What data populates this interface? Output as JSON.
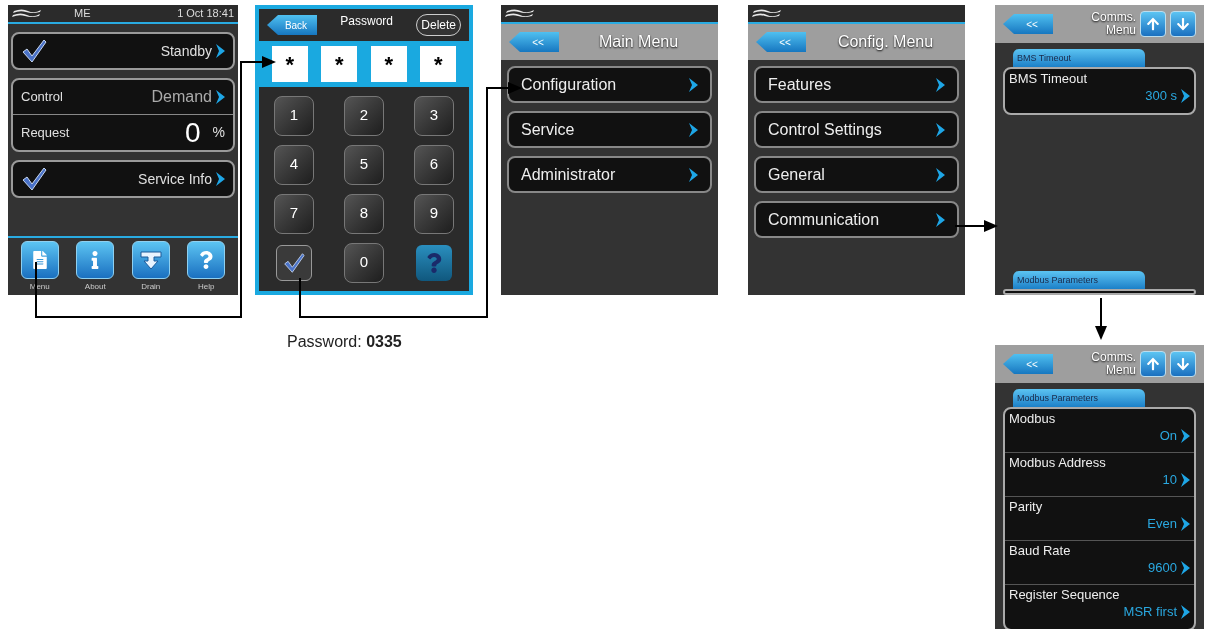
{
  "home_screen": {
    "status_bar": {
      "label": "ME",
      "datetime": "1 Oct 18:41"
    },
    "status_button": {
      "checked": true,
      "label": "Standby"
    },
    "control": {
      "label": "Control",
      "value": "Demand"
    },
    "request": {
      "label": "Request",
      "value": "0",
      "unit": "%"
    },
    "service_button": {
      "checked": true,
      "label": "Service Info"
    },
    "toolbar": [
      {
        "kind": "menu",
        "label": "Menu"
      },
      {
        "kind": "info",
        "label": "About"
      },
      {
        "kind": "drain",
        "label": "Drain"
      },
      {
        "kind": "help",
        "label": "Help"
      }
    ]
  },
  "password_screen": {
    "back": "Back",
    "title": "Password",
    "delete": "Delete",
    "digits": [
      "*",
      "*",
      "*",
      "*"
    ],
    "keys": [
      {
        "kind": "digit",
        "label": "1"
      },
      {
        "kind": "digit",
        "label": "2"
      },
      {
        "kind": "digit",
        "label": "3"
      },
      {
        "kind": "digit",
        "label": "4"
      },
      {
        "kind": "digit",
        "label": "5"
      },
      {
        "kind": "digit",
        "label": "6"
      },
      {
        "kind": "digit",
        "label": "7"
      },
      {
        "kind": "digit",
        "label": "8"
      },
      {
        "kind": "digit",
        "label": "9"
      },
      {
        "kind": "confirm"
      },
      {
        "kind": "digit",
        "label": "0"
      },
      {
        "kind": "help"
      }
    ]
  },
  "caption": "Password: **0335**",
  "main_menu": {
    "back": "<<",
    "title": "Main Menu",
    "items": [
      "Configuration",
      "Service",
      "Administrator"
    ]
  },
  "config_menu": {
    "back": "<<",
    "title": "Config. Menu",
    "items": [
      "Features",
      "Control Settings",
      "General",
      "Communication"
    ]
  },
  "comms_menu_views": [
    {
      "back": "<<",
      "title": "Comms. Menu",
      "sections": [
        {
          "title": "BMS Timeout",
          "items": [
            {
              "label": "BMS Timeout",
              "value": "300 s"
            }
          ]
        },
        {
          "title": "Modbus Parameters"
        }
      ]
    },
    {
      "back": "<<",
      "title": "Comms. Menu",
      "sections": [
        {
          "title": "Modbus Parameters",
          "items": [
            {
              "label": "Modbus",
              "value": "On"
            },
            {
              "label": "Modbus Address",
              "value": "10"
            },
            {
              "label": "Parity",
              "value": "Even"
            },
            {
              "label": "Baud Rate",
              "value": "9600"
            },
            {
              "label": "Register Sequence",
              "value": "MSR first"
            }
          ]
        }
      ]
    }
  ]
}
